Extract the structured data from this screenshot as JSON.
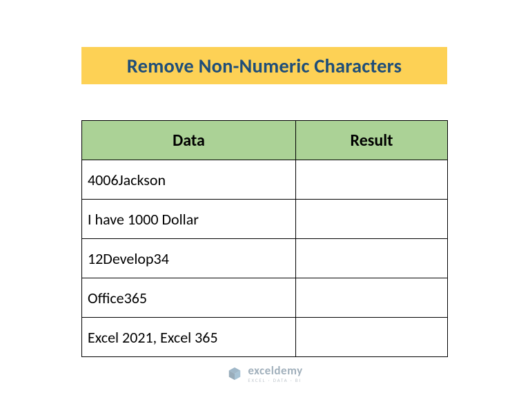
{
  "title": "Remove Non-Numeric Characters",
  "headers": {
    "data": "Data",
    "result": "Result"
  },
  "rows": [
    {
      "data": "4006Jackson",
      "result": ""
    },
    {
      "data": "I have 1000 Dollar",
      "result": ""
    },
    {
      "data": "12Develop34",
      "result": ""
    },
    {
      "data": "Office365",
      "result": ""
    },
    {
      "data": "Excel 2021, Excel 365",
      "result": ""
    }
  ],
  "watermark": {
    "brand": "exceldemy",
    "tag": "EXCEL · DATA · BI"
  }
}
